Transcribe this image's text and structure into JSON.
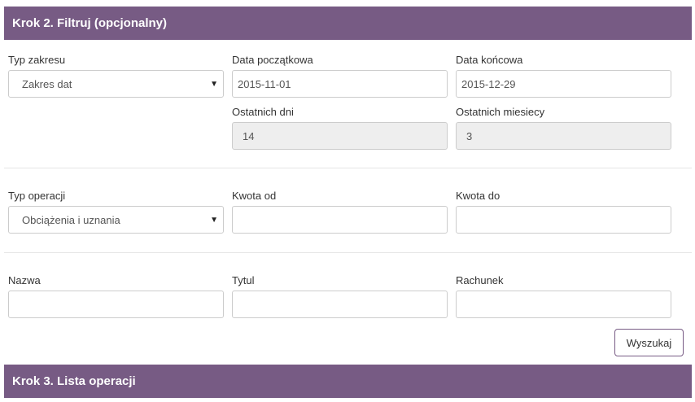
{
  "step2": {
    "title": "Krok 2. Filtruj (opcjonalny)"
  },
  "step3": {
    "title": "Krok 3. Lista operacji"
  },
  "range_type": {
    "label": "Typ zakresu",
    "value": "Zakres dat"
  },
  "date_start": {
    "label": "Data początkowa",
    "value": "2015-11-01"
  },
  "date_end": {
    "label": "Data końcowa",
    "value": "2015-12-29"
  },
  "last_days": {
    "label": "Ostatnich dni",
    "value": "14"
  },
  "last_months": {
    "label": "Ostatnich miesiecy",
    "value": "3"
  },
  "operation_type": {
    "label": "Typ operacji",
    "value": "Obciążenia i uznania"
  },
  "amount_from": {
    "label": "Kwota od",
    "value": ""
  },
  "amount_to": {
    "label": "Kwota do",
    "value": ""
  },
  "name": {
    "label": "Nazwa",
    "value": ""
  },
  "title_field": {
    "label": "Tytul",
    "value": ""
  },
  "account": {
    "label": "Rachunek",
    "value": ""
  },
  "search_button": {
    "label": "Wyszukaj"
  },
  "colors": {
    "header_bg": "#775b84",
    "disabled_bg": "#eeeeee",
    "border": "#cccccc"
  },
  "icons": {
    "select_caret": "caret-down-icon"
  }
}
